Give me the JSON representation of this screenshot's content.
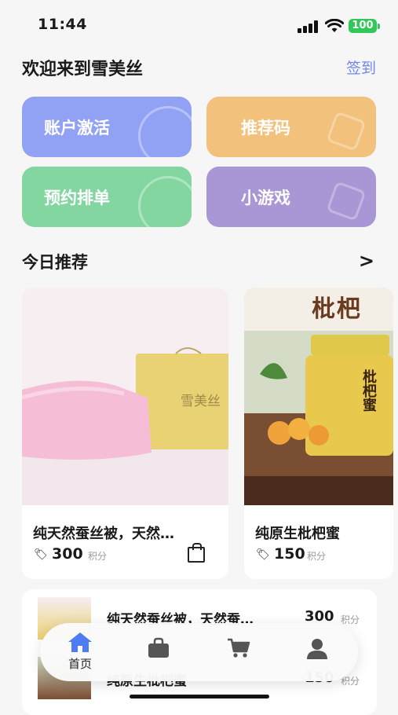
{
  "status_bar": {
    "time": "11:44",
    "battery": "100"
  },
  "header": {
    "welcome": "欢迎来到雪美丝",
    "signin": "签到"
  },
  "tiles": [
    {
      "label": "账户激活",
      "color": "#91a2f4"
    },
    {
      "label": "推荐码",
      "color": "#f2c27c"
    },
    {
      "label": "预约排单",
      "color": "#84d6a1"
    },
    {
      "label": "小游戏",
      "color": "#a996d4"
    }
  ],
  "recommend": {
    "title": "今日推荐",
    "arrow": ">",
    "products": [
      {
        "name": "纯天然蚕丝被，天然…",
        "price": "300",
        "unit": "积分",
        "brand": "雪美丝"
      },
      {
        "name": "纯原生枇杷蜜",
        "price": "150",
        "unit": "积分",
        "banner": "枇杷",
        "jar_label": "枇杷蜜"
      }
    ]
  },
  "list": [
    {
      "name": "纯天然蚕丝被，天然蚕…",
      "price": "300",
      "unit": "积分"
    },
    {
      "name": "纯原生枇杷蜜",
      "price": "150",
      "unit": "积分"
    }
  ],
  "tabbar": {
    "items": [
      {
        "label": "首页",
        "icon": "home-icon",
        "active": true
      },
      {
        "label": "",
        "icon": "shop-bag-icon"
      },
      {
        "label": "",
        "icon": "cart-icon"
      },
      {
        "label": "",
        "icon": "user-icon"
      }
    ],
    "active_color": "#4f7cf3"
  }
}
